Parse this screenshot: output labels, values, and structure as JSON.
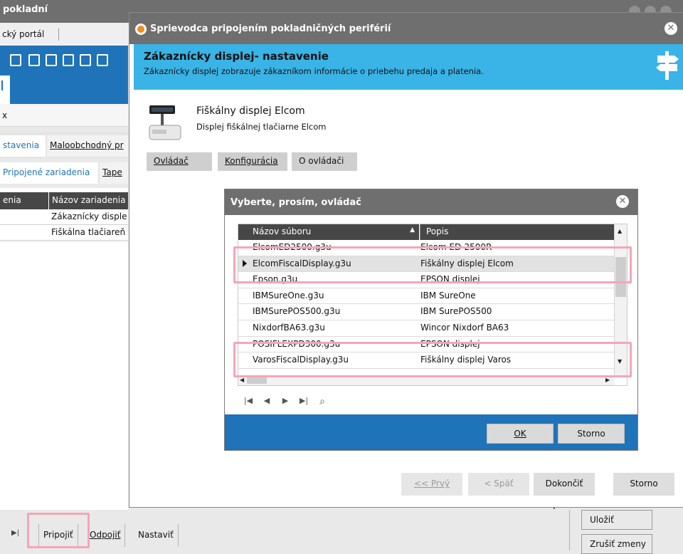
{
  "background_app": {
    "title": "pokladní",
    "portal_label": "cký portál",
    "x_label": "x",
    "subtabs": [
      "stavenia",
      "Maloobchodný pr"
    ],
    "subtabs2": [
      "Pripojené zariadenia",
      "Tape"
    ],
    "table_headers": [
      "enia",
      "Názov zariadenia"
    ],
    "table_rows": [
      "Zákaznícky disple",
      "Fiškálna tlačiareň"
    ],
    "bottom_buttons": [
      "Pripojiť",
      "Odpojiť",
      "Nastaviť"
    ],
    "right_buttons": [
      "Uložiť",
      "Zrušiť zmeny"
    ],
    "nav_icon": "skip-last-icon"
  },
  "wizard": {
    "title": "Sprievodca pripojením pokladničných periférií",
    "banner_title": "Zákaznícky displej- nastavenie",
    "banner_subtitle": "Zákaznícky displej zobrazuje zákazníkom informácie o priebehu predaja a platenia.",
    "device_title": "Fiškálny displej Elcom",
    "device_subtitle": "Displej fiškálnej tlačiarne Elcom",
    "device_buttons": [
      "Ovládač",
      "Konfigurácia",
      "O ovládači"
    ],
    "footer_buttons": [
      {
        "label": "<< Prvý",
        "enabled": false
      },
      {
        "label": "< Späť",
        "enabled": false
      },
      {
        "label": "Dokončiť",
        "enabled": true
      },
      {
        "label": "Storno",
        "enabled": true
      }
    ]
  },
  "driver_dialog": {
    "title": "Vyberte, prosím, ovládač",
    "columns": [
      "Názov súboru",
      "Popis"
    ],
    "rows": [
      {
        "file": "ElcomED2500.g3u",
        "desc": "Elcom ED-2500R",
        "selected": false
      },
      {
        "file": "ElcomFiscalDisplay.g3u",
        "desc": "Fiškálny displej Elcom",
        "selected": true
      },
      {
        "file": "Epson.g3u",
        "desc": "EPSON displej",
        "selected": false
      },
      {
        "file": "IBMSureOne.g3u",
        "desc": "IBM SureOne",
        "selected": false
      },
      {
        "file": "IBMSurePOS500.g3u",
        "desc": "IBM SurePOS500",
        "selected": false
      },
      {
        "file": "NixdorfBA63.g3u",
        "desc": "Wincor Nixdorf BA63",
        "selected": false
      },
      {
        "file": "POSIFLEXPD300.g3u",
        "desc": "EPSON displej",
        "selected": false
      },
      {
        "file": "VarosFiscalDisplay.g3u",
        "desc": "Fiškálny displej Varos",
        "selected": false
      }
    ],
    "ok_label": "OK",
    "cancel_label": "Storno"
  },
  "colors": {
    "titlebar": "#6f6f6f",
    "accent_blue": "#1f73b8",
    "banner": "#3ab3e6",
    "highlight": "#f4a6b8",
    "grid_header": "#474747"
  }
}
